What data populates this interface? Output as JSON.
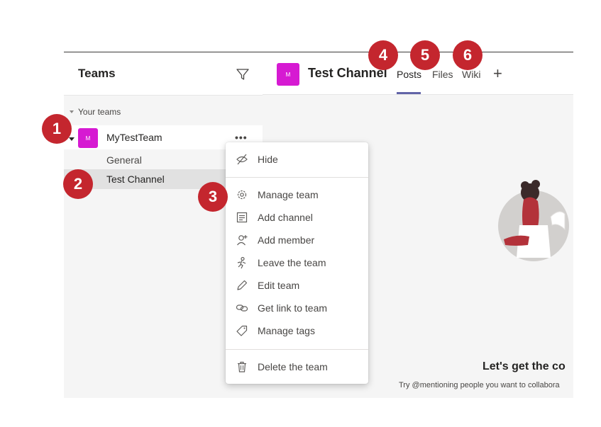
{
  "left_panel": {
    "title": "Teams",
    "filter_icon": "filter-icon",
    "section_label": "Your teams",
    "team": {
      "avatar_text": "M",
      "name": "MyTestTeam",
      "more_icon": "more-options-icon",
      "more_text": "•••"
    },
    "channels": [
      {
        "label": "General"
      },
      {
        "label": "Test Channel"
      }
    ]
  },
  "main": {
    "channel_avatar_text": "M",
    "channel_title": "Test Channel",
    "tabs": [
      {
        "label": "Posts",
        "active": true
      },
      {
        "label": "Files"
      },
      {
        "label": "Wiki"
      }
    ],
    "add_tab_label": "+",
    "cta_title": "Let's get the co",
    "cta_subtitle": "Try @mentioning people you want to collabora"
  },
  "menu": {
    "items": [
      {
        "label": "Hide",
        "icon": "hide-icon"
      },
      {
        "label": "Manage team",
        "icon": "gear-icon"
      },
      {
        "label": "Add channel",
        "icon": "add-channel-icon"
      },
      {
        "label": "Add member",
        "icon": "add-member-icon"
      },
      {
        "label": "Leave the team",
        "icon": "leave-icon"
      },
      {
        "label": "Edit team",
        "icon": "pencil-icon"
      },
      {
        "label": "Get link to team",
        "icon": "link-icon"
      },
      {
        "label": "Manage tags",
        "icon": "tag-icon"
      },
      {
        "label": "Delete the team",
        "icon": "trash-icon"
      }
    ]
  },
  "badges": [
    "1",
    "2",
    "3",
    "4",
    "5",
    "6"
  ],
  "colors": {
    "badge": "#c4262e",
    "avatar": "#d61ad2",
    "accent": "#6264a7"
  }
}
